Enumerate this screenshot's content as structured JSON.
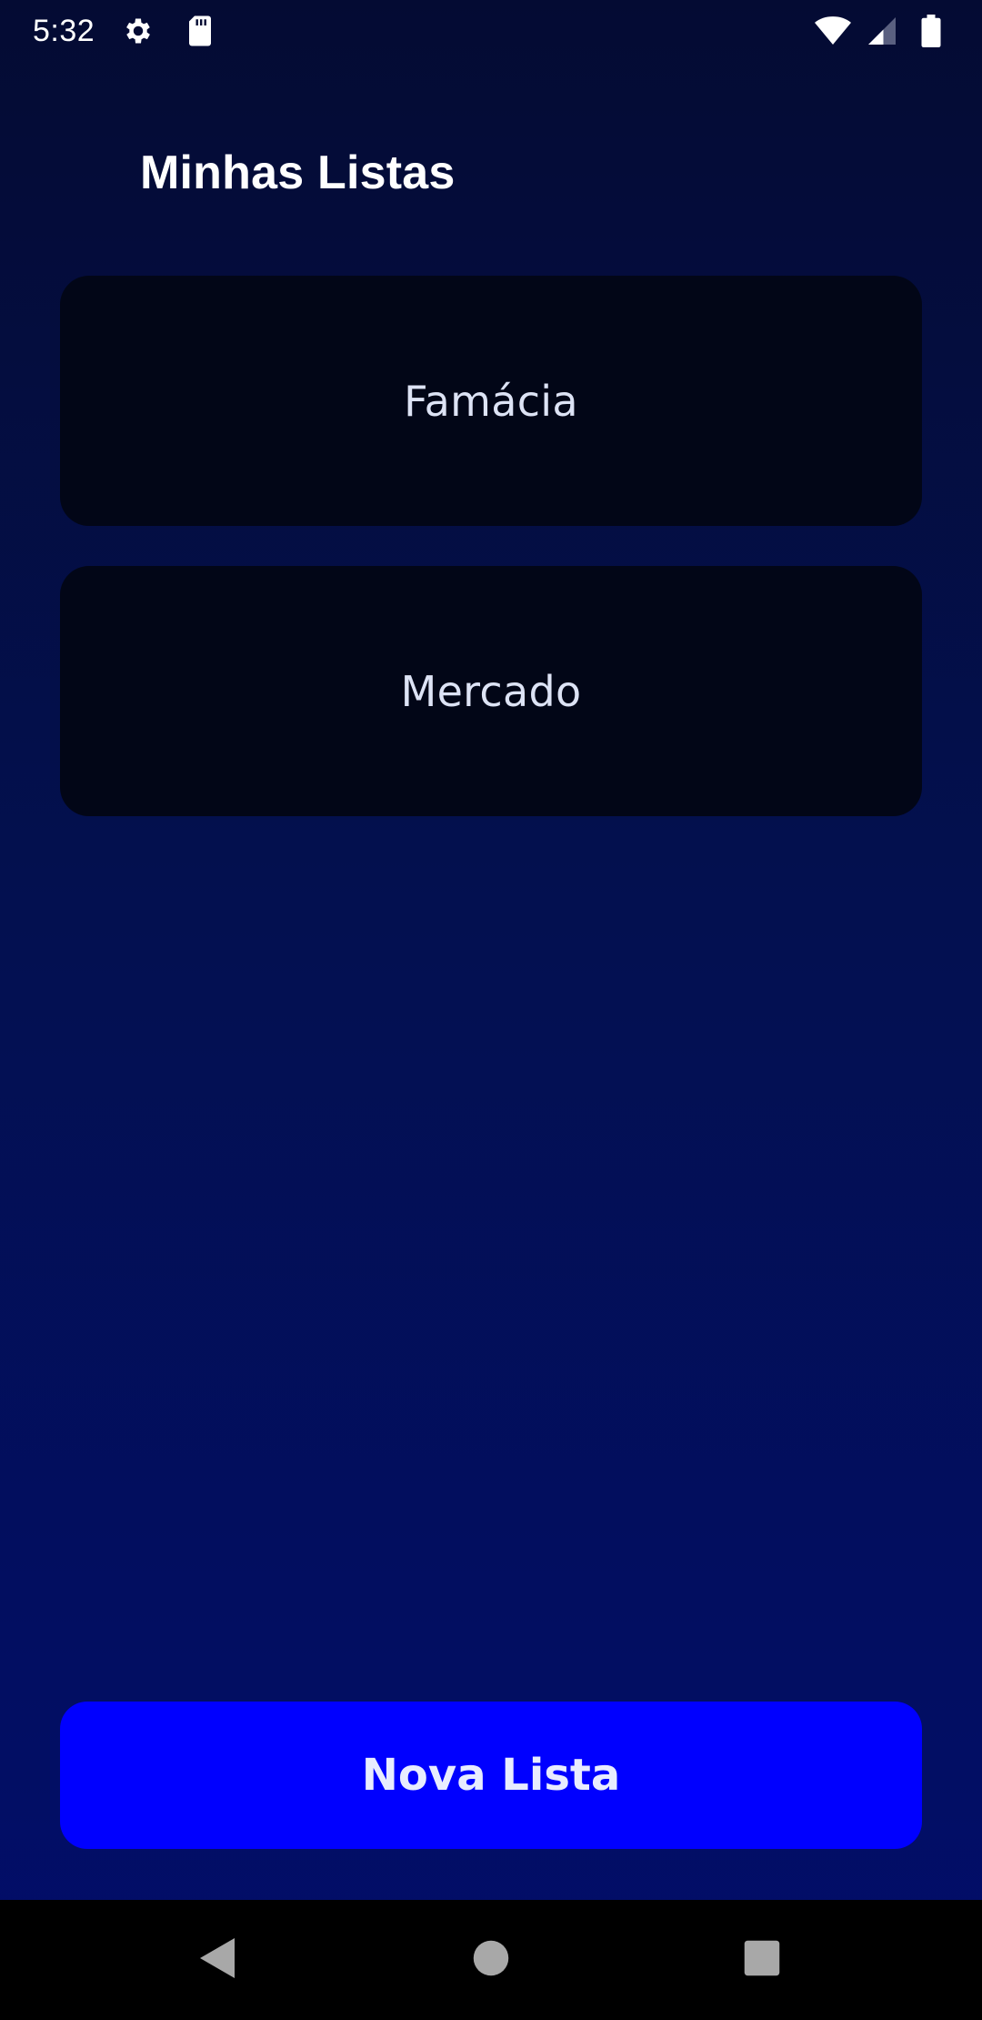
{
  "status_bar": {
    "time": "5:32",
    "icons_left": [
      "gear-icon",
      "sd-card-icon"
    ],
    "icons_right": [
      "wifi-icon",
      "signal-icon",
      "battery-icon"
    ]
  },
  "header": {
    "title": "Minhas Listas"
  },
  "lists": [
    {
      "label": "Famácia"
    },
    {
      "label": "Mercado"
    }
  ],
  "actions": {
    "new_list_label": "Nova Lista"
  },
  "navigation": {
    "buttons": [
      "back-icon",
      "home-icon",
      "recents-icon"
    ]
  },
  "colors": {
    "background_top": "#040b33",
    "background_bottom": "#020d6a",
    "card": "#020617",
    "primary_button": "#0000ff",
    "nav_bar": "#000000"
  }
}
